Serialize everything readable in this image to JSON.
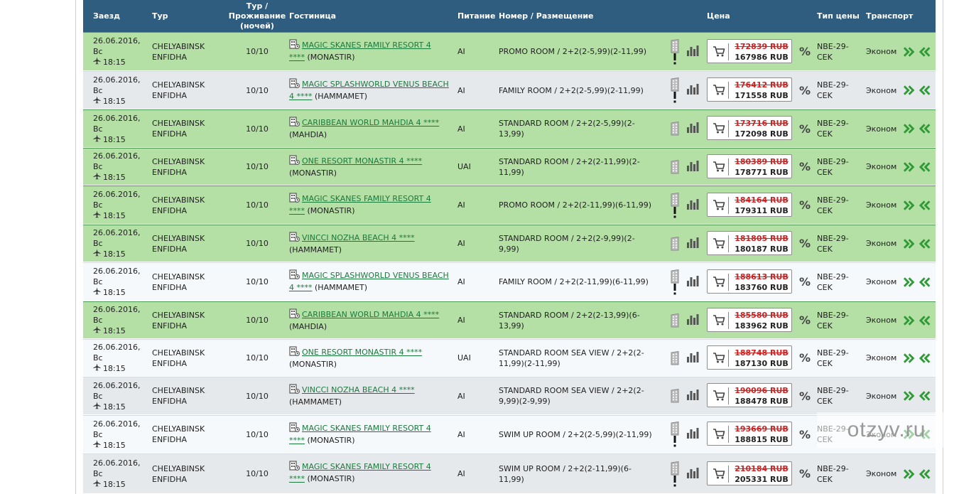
{
  "header": {
    "date": "Заезд",
    "tour": "Тур",
    "nights_line1": "Тур /",
    "nights_line2": "Проживание",
    "nights_line3": "(ночей)",
    "hotel": "Гостиница",
    "food": "Питание",
    "room": "Номер / Размещение",
    "price": "Цена",
    "price_type": "Тип цены",
    "transport": "Транспорт"
  },
  "colors": {
    "header": "#2f5d80",
    "green_row": "#b4dfa5",
    "link": "#1a7a3c",
    "old_price": "#d32020"
  },
  "rows": [
    {
      "date": "26.06.2016, Вс",
      "time": "18:15",
      "from": "CHELYABINSK",
      "to": "ENFIDHA",
      "nights": "10/10",
      "hotel": "MAGIC SKANES FAMILY RESORT 4 ****",
      "city": "(MONASTIR)",
      "food": "AI",
      "room": "PROMO ROOM / 2+2(2-5,99)(2-11,99)",
      "old_price": "172839 RUB",
      "price": "167986 RUB",
      "ptype1": "NBE-29-",
      "ptype2": "CEK",
      "transport": "Эконом",
      "warn": true,
      "style": "green"
    },
    {
      "date": "26.06.2016, Вс",
      "time": "18:15",
      "from": "CHELYABINSK",
      "to": "ENFIDHA",
      "nights": "10/10",
      "hotel": "MAGIC SPLASHWORLD VENUS BEACH 4 ****",
      "city": "(HAMMAMET)",
      "food": "AI",
      "room": "FAMILY ROOM / 2+2(2-5,99)(2-11,99)",
      "old_price": "176412 RUB",
      "price": "171558 RUB",
      "ptype1": "NBE-29-",
      "ptype2": "CEK",
      "transport": "Эконом",
      "warn": true,
      "style": "grey"
    },
    {
      "date": "26.06.2016, Вс",
      "time": "18:15",
      "from": "CHELYABINSK",
      "to": "ENFIDHA",
      "nights": "10/10",
      "hotel": "CARIBBEAN WORLD MAHDIA 4 ****",
      "city": "(MAHDIA)",
      "food": "AI",
      "room": "STANDARD ROOM / 2+2(2-5,99)(2-13,99)",
      "old_price": "173716 RUB",
      "price": "172098 RUB",
      "ptype1": "NBE-29-",
      "ptype2": "CEK",
      "transport": "Эконом",
      "warn": false,
      "style": "green"
    },
    {
      "date": "26.06.2016, Вс",
      "time": "18:15",
      "from": "CHELYABINSK",
      "to": "ENFIDHA",
      "nights": "10/10",
      "hotel": "ONE RESORT MONASTIR 4 ****",
      "city": "(MONASTIR)",
      "food": "UAI",
      "room": "STANDARD ROOM / 2+2(2-11,99)(2-11,99)",
      "old_price": "180389 RUB",
      "price": "178771 RUB",
      "ptype1": "NBE-29-",
      "ptype2": "CEK",
      "transport": "Эконом",
      "warn": false,
      "style": "green"
    },
    {
      "date": "26.06.2016, Вс",
      "time": "18:15",
      "from": "CHELYABINSK",
      "to": "ENFIDHA",
      "nights": "10/10",
      "hotel": "MAGIC SKANES FAMILY RESORT 4 ****",
      "city": "(MONASTIR)",
      "food": "AI",
      "room": "PROMO ROOM / 2+2(2-11,99)(6-11,99)",
      "old_price": "184164 RUB",
      "price": "179311 RUB",
      "ptype1": "NBE-29-",
      "ptype2": "CEK",
      "transport": "Эконом",
      "warn": true,
      "style": "green"
    },
    {
      "date": "26.06.2016, Вс",
      "time": "18:15",
      "from": "CHELYABINSK",
      "to": "ENFIDHA",
      "nights": "10/10",
      "hotel": "VINCCI NOZHA BEACH 4 ****",
      "city": "(HAMMAMET)",
      "food": "AI",
      "room": "STANDARD ROOM / 2+2(2-9,99)(2-9,99)",
      "old_price": "181805 RUB",
      "price": "180187 RUB",
      "ptype1": "NBE-29-",
      "ptype2": "CEK",
      "transport": "Эконом",
      "warn": false,
      "style": "green"
    },
    {
      "date": "26.06.2016, Вс",
      "time": "18:15",
      "from": "CHELYABINSK",
      "to": "ENFIDHA",
      "nights": "10/10",
      "hotel": "MAGIC SPLASHWORLD VENUS BEACH 4 ****",
      "city": "(HAMMAMET)",
      "food": "AI",
      "room": "FAMILY ROOM / 2+2(2-11,99)(6-11,99)",
      "old_price": "188613 RUB",
      "price": "183760 RUB",
      "ptype1": "NBE-29-",
      "ptype2": "CEK",
      "transport": "Эконом",
      "warn": true,
      "style": "white"
    },
    {
      "date": "26.06.2016, Вс",
      "time": "18:15",
      "from": "CHELYABINSK",
      "to": "ENFIDHA",
      "nights": "10/10",
      "hotel": "CARIBBEAN WORLD MAHDIA 4 ****",
      "city": "(MAHDIA)",
      "food": "AI",
      "room": "STANDARD ROOM / 2+2(2-13,99)(6-13,99)",
      "old_price": "185580 RUB",
      "price": "183962 RUB",
      "ptype1": "NBE-29-",
      "ptype2": "CEK",
      "transport": "Эконом",
      "warn": false,
      "style": "green"
    },
    {
      "date": "26.06.2016, Вс",
      "time": "18:15",
      "from": "CHELYABINSK",
      "to": "ENFIDHA",
      "nights": "10/10",
      "hotel": "ONE RESORT MONASTIR 4 ****",
      "city": "(MONASTIR)",
      "food": "UAI",
      "room": "STANDARD ROOM SEA VIEW / 2+2(2-11,99)(2-11,99)",
      "old_price": "188748 RUB",
      "price": "187130 RUB",
      "ptype1": "NBE-29-",
      "ptype2": "CEK",
      "transport": "Эконом",
      "warn": false,
      "style": "white"
    },
    {
      "date": "26.06.2016, Вс",
      "time": "18:15",
      "from": "CHELYABINSK",
      "to": "ENFIDHA",
      "nights": "10/10",
      "hotel": "VINCCI NOZHA BEACH 4 ****",
      "city": "(HAMMAMET)",
      "food": "AI",
      "room": "STANDARD ROOM SEA VIEW / 2+2(2-9,99)(2-9,99)",
      "old_price": "190096 RUB",
      "price": "188478 RUB",
      "ptype1": "NBE-29-",
      "ptype2": "CEK",
      "transport": "Эконом",
      "warn": false,
      "style": "grey"
    },
    {
      "date": "26.06.2016, Вс",
      "time": "18:15",
      "from": "CHELYABINSK",
      "to": "ENFIDHA",
      "nights": "10/10",
      "hotel": "MAGIC SKANES FAMILY RESORT 4 ****",
      "city": "(MONASTIR)",
      "food": "AI",
      "room": "SWIM UP ROOM / 2+2(2-5,99)(2-11,99)",
      "old_price": "193669 RUB",
      "price": "188815 RUB",
      "ptype1": "NBE-29-",
      "ptype2": "CEK",
      "transport": "Эконом",
      "warn": true,
      "style": "white"
    },
    {
      "date": "26.06.2016, Вс",
      "time": "18:15",
      "from": "CHELYABINSK",
      "to": "ENFIDHA",
      "nights": "10/10",
      "hotel": "MAGIC SKANES FAMILY RESORT 4 ****",
      "city": "(MONASTIR)",
      "food": "AI",
      "room": "SWIM UP ROOM / 2+2(2-11,99)(6-11,99)",
      "old_price": "210184 RUB",
      "price": "205331 RUB",
      "ptype1": "NBE-29-",
      "ptype2": "CEK",
      "transport": "Эконом",
      "warn": true,
      "style": "grey"
    }
  ],
  "watermark": "otzyv.ru"
}
